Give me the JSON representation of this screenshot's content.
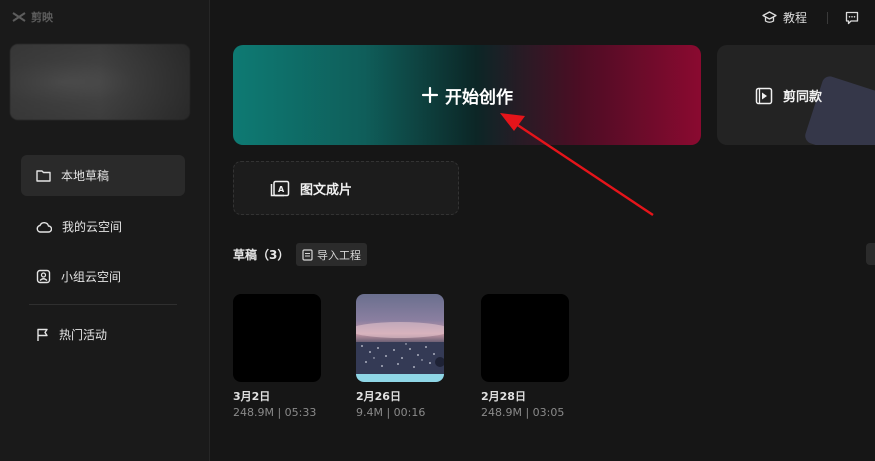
{
  "app": {
    "logo_text": "剪映"
  },
  "sidebar": {
    "items": [
      {
        "label": "本地草稿",
        "icon": "folder-icon",
        "active": true
      },
      {
        "label": "我的云空间",
        "icon": "cloud-icon",
        "active": false
      },
      {
        "label": "小组云空间",
        "icon": "team-cloud-icon",
        "active": false
      },
      {
        "label": "热门活动",
        "icon": "flag-icon",
        "active": false
      }
    ]
  },
  "topbar": {
    "tutorial_label": "教程",
    "tutorial_icon": "graduation-cap-icon",
    "feedback_icon": "message-icon"
  },
  "main": {
    "start_create_label": "开始创作",
    "template_label": "剪同款",
    "text_to_video_label": "图文成片",
    "drafts_title": "草稿（3）",
    "import_label": "导入工程"
  },
  "drafts": [
    {
      "name": "3月2日",
      "meta": "248.9M | 05:33",
      "thumb": "black"
    },
    {
      "name": "2月26日",
      "meta": "9.4M | 00:16",
      "thumb": "photo"
    },
    {
      "name": "2月28日",
      "meta": "248.9M | 03:05",
      "thumb": "black"
    }
  ],
  "colors": {
    "accent_arrow": "#e5141a",
    "start_gradient_left": "#0e7a73",
    "start_gradient_right": "#8a0a30"
  }
}
